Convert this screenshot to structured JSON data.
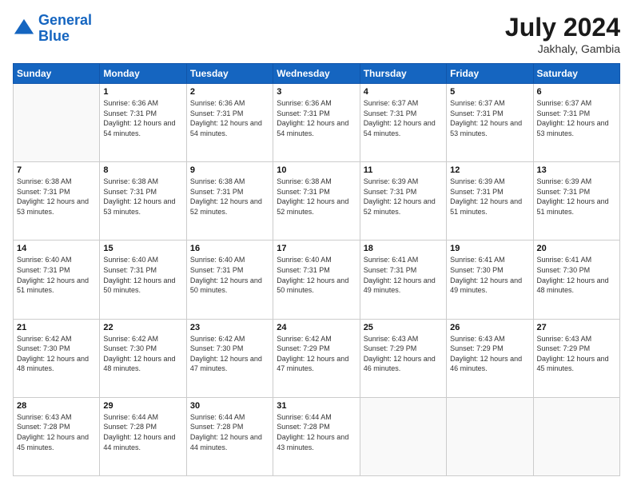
{
  "logo": {
    "line1": "General",
    "line2": "Blue"
  },
  "title": "July 2024",
  "location": "Jakhaly, Gambia",
  "days_header": [
    "Sunday",
    "Monday",
    "Tuesday",
    "Wednesday",
    "Thursday",
    "Friday",
    "Saturday"
  ],
  "weeks": [
    [
      {
        "day": "",
        "sunrise": "",
        "sunset": "",
        "daylight": ""
      },
      {
        "day": "1",
        "sunrise": "Sunrise: 6:36 AM",
        "sunset": "Sunset: 7:31 PM",
        "daylight": "Daylight: 12 hours and 54 minutes."
      },
      {
        "day": "2",
        "sunrise": "Sunrise: 6:36 AM",
        "sunset": "Sunset: 7:31 PM",
        "daylight": "Daylight: 12 hours and 54 minutes."
      },
      {
        "day": "3",
        "sunrise": "Sunrise: 6:36 AM",
        "sunset": "Sunset: 7:31 PM",
        "daylight": "Daylight: 12 hours and 54 minutes."
      },
      {
        "day": "4",
        "sunrise": "Sunrise: 6:37 AM",
        "sunset": "Sunset: 7:31 PM",
        "daylight": "Daylight: 12 hours and 54 minutes."
      },
      {
        "day": "5",
        "sunrise": "Sunrise: 6:37 AM",
        "sunset": "Sunset: 7:31 PM",
        "daylight": "Daylight: 12 hours and 53 minutes."
      },
      {
        "day": "6",
        "sunrise": "Sunrise: 6:37 AM",
        "sunset": "Sunset: 7:31 PM",
        "daylight": "Daylight: 12 hours and 53 minutes."
      }
    ],
    [
      {
        "day": "7",
        "sunrise": "Sunrise: 6:38 AM",
        "sunset": "Sunset: 7:31 PM",
        "daylight": "Daylight: 12 hours and 53 minutes."
      },
      {
        "day": "8",
        "sunrise": "Sunrise: 6:38 AM",
        "sunset": "Sunset: 7:31 PM",
        "daylight": "Daylight: 12 hours and 53 minutes."
      },
      {
        "day": "9",
        "sunrise": "Sunrise: 6:38 AM",
        "sunset": "Sunset: 7:31 PM",
        "daylight": "Daylight: 12 hours and 52 minutes."
      },
      {
        "day": "10",
        "sunrise": "Sunrise: 6:38 AM",
        "sunset": "Sunset: 7:31 PM",
        "daylight": "Daylight: 12 hours and 52 minutes."
      },
      {
        "day": "11",
        "sunrise": "Sunrise: 6:39 AM",
        "sunset": "Sunset: 7:31 PM",
        "daylight": "Daylight: 12 hours and 52 minutes."
      },
      {
        "day": "12",
        "sunrise": "Sunrise: 6:39 AM",
        "sunset": "Sunset: 7:31 PM",
        "daylight": "Daylight: 12 hours and 51 minutes."
      },
      {
        "day": "13",
        "sunrise": "Sunrise: 6:39 AM",
        "sunset": "Sunset: 7:31 PM",
        "daylight": "Daylight: 12 hours and 51 minutes."
      }
    ],
    [
      {
        "day": "14",
        "sunrise": "Sunrise: 6:40 AM",
        "sunset": "Sunset: 7:31 PM",
        "daylight": "Daylight: 12 hours and 51 minutes."
      },
      {
        "day": "15",
        "sunrise": "Sunrise: 6:40 AM",
        "sunset": "Sunset: 7:31 PM",
        "daylight": "Daylight: 12 hours and 50 minutes."
      },
      {
        "day": "16",
        "sunrise": "Sunrise: 6:40 AM",
        "sunset": "Sunset: 7:31 PM",
        "daylight": "Daylight: 12 hours and 50 minutes."
      },
      {
        "day": "17",
        "sunrise": "Sunrise: 6:40 AM",
        "sunset": "Sunset: 7:31 PM",
        "daylight": "Daylight: 12 hours and 50 minutes."
      },
      {
        "day": "18",
        "sunrise": "Sunrise: 6:41 AM",
        "sunset": "Sunset: 7:31 PM",
        "daylight": "Daylight: 12 hours and 49 minutes."
      },
      {
        "day": "19",
        "sunrise": "Sunrise: 6:41 AM",
        "sunset": "Sunset: 7:30 PM",
        "daylight": "Daylight: 12 hours and 49 minutes."
      },
      {
        "day": "20",
        "sunrise": "Sunrise: 6:41 AM",
        "sunset": "Sunset: 7:30 PM",
        "daylight": "Daylight: 12 hours and 48 minutes."
      }
    ],
    [
      {
        "day": "21",
        "sunrise": "Sunrise: 6:42 AM",
        "sunset": "Sunset: 7:30 PM",
        "daylight": "Daylight: 12 hours and 48 minutes."
      },
      {
        "day": "22",
        "sunrise": "Sunrise: 6:42 AM",
        "sunset": "Sunset: 7:30 PM",
        "daylight": "Daylight: 12 hours and 48 minutes."
      },
      {
        "day": "23",
        "sunrise": "Sunrise: 6:42 AM",
        "sunset": "Sunset: 7:30 PM",
        "daylight": "Daylight: 12 hours and 47 minutes."
      },
      {
        "day": "24",
        "sunrise": "Sunrise: 6:42 AM",
        "sunset": "Sunset: 7:29 PM",
        "daylight": "Daylight: 12 hours and 47 minutes."
      },
      {
        "day": "25",
        "sunrise": "Sunrise: 6:43 AM",
        "sunset": "Sunset: 7:29 PM",
        "daylight": "Daylight: 12 hours and 46 minutes."
      },
      {
        "day": "26",
        "sunrise": "Sunrise: 6:43 AM",
        "sunset": "Sunset: 7:29 PM",
        "daylight": "Daylight: 12 hours and 46 minutes."
      },
      {
        "day": "27",
        "sunrise": "Sunrise: 6:43 AM",
        "sunset": "Sunset: 7:29 PM",
        "daylight": "Daylight: 12 hours and 45 minutes."
      }
    ],
    [
      {
        "day": "28",
        "sunrise": "Sunrise: 6:43 AM",
        "sunset": "Sunset: 7:28 PM",
        "daylight": "Daylight: 12 hours and 45 minutes."
      },
      {
        "day": "29",
        "sunrise": "Sunrise: 6:44 AM",
        "sunset": "Sunset: 7:28 PM",
        "daylight": "Daylight: 12 hours and 44 minutes."
      },
      {
        "day": "30",
        "sunrise": "Sunrise: 6:44 AM",
        "sunset": "Sunset: 7:28 PM",
        "daylight": "Daylight: 12 hours and 44 minutes."
      },
      {
        "day": "31",
        "sunrise": "Sunrise: 6:44 AM",
        "sunset": "Sunset: 7:28 PM",
        "daylight": "Daylight: 12 hours and 43 minutes."
      },
      {
        "day": "",
        "sunrise": "",
        "sunset": "",
        "daylight": ""
      },
      {
        "day": "",
        "sunrise": "",
        "sunset": "",
        "daylight": ""
      },
      {
        "day": "",
        "sunrise": "",
        "sunset": "",
        "daylight": ""
      }
    ]
  ]
}
